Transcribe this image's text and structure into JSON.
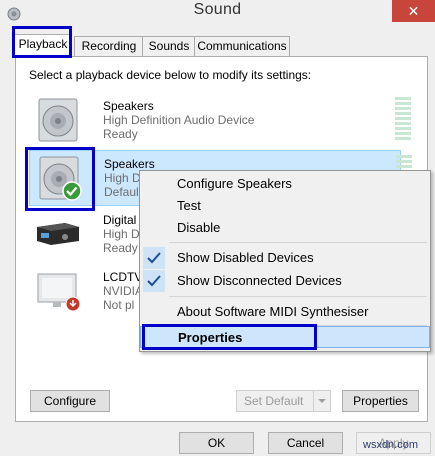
{
  "window": {
    "title": "Sound",
    "close_icon": "close-icon"
  },
  "tabs": [
    {
      "label": "Playback",
      "active": true
    },
    {
      "label": "Recording"
    },
    {
      "label": "Sounds"
    },
    {
      "label": "Communications"
    }
  ],
  "instruction": "Select a playback device below to modify its settings:",
  "devices": [
    {
      "name": "Speakers",
      "line2": "High Definition Audio Device",
      "line3": "Ready",
      "icon": "speaker-icon"
    },
    {
      "name": "Speakers",
      "line2": "High D",
      "line3": "Defaul",
      "icon": "speaker-default-icon",
      "selected": true
    },
    {
      "name": "Digital",
      "line2": "High D",
      "line3": "Ready",
      "icon": "receiver-icon"
    },
    {
      "name": "LCDTV",
      "line2": "NVIDIA",
      "line3": "Not pl",
      "icon": "tv-icon"
    }
  ],
  "context_menu": {
    "configure": "Configure Speakers",
    "test": "Test",
    "disable": "Disable",
    "show_disabled": "Show Disabled Devices",
    "show_disconnected": "Show Disconnected Devices",
    "about_midi": "About Software MIDI Synthesiser",
    "properties": "Properties"
  },
  "buttons": {
    "configure": "Configure",
    "set_default": "Set Default",
    "properties": "Properties",
    "ok": "OK",
    "cancel": "Cancel",
    "apply": "Apply"
  },
  "watermark": "wsxdn.com",
  "colors": {
    "highlight_box": "#0000c8",
    "selection": "#cce8ff",
    "close": "#c7453b"
  }
}
